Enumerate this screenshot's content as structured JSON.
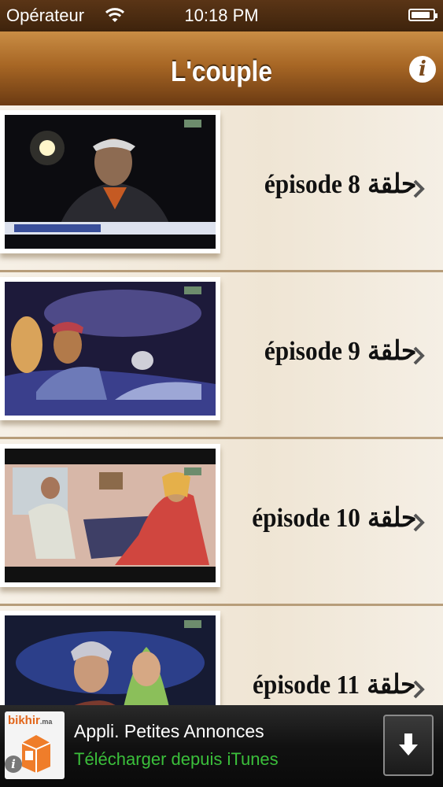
{
  "status_bar": {
    "carrier": "Opérateur",
    "time": "10:18 PM",
    "battery_level": 0.9
  },
  "navbar": {
    "title": "L'couple",
    "info_icon": "info-icon"
  },
  "episodes": [
    {
      "label": "épisode",
      "number": "8",
      "arabic": "حلقة"
    },
    {
      "label": "épisode",
      "number": "9",
      "arabic": "حلقة"
    },
    {
      "label": "épisode",
      "number": "10",
      "arabic": "حلقة"
    },
    {
      "label": "épisode",
      "number": "11",
      "arabic": "حلقة"
    }
  ],
  "ad": {
    "brand": "bikhir",
    "brand_suffix": ".ma",
    "title": "Appli. Petites Annonces",
    "subtitle": "Télécharger depuis iTunes",
    "download_icon": "download-arrow-icon"
  },
  "colors": {
    "nav_top": "#c98d45",
    "nav_bottom": "#6b3a12",
    "row_bg": "#f3ece0",
    "itunes_green": "#3bbf3b"
  }
}
